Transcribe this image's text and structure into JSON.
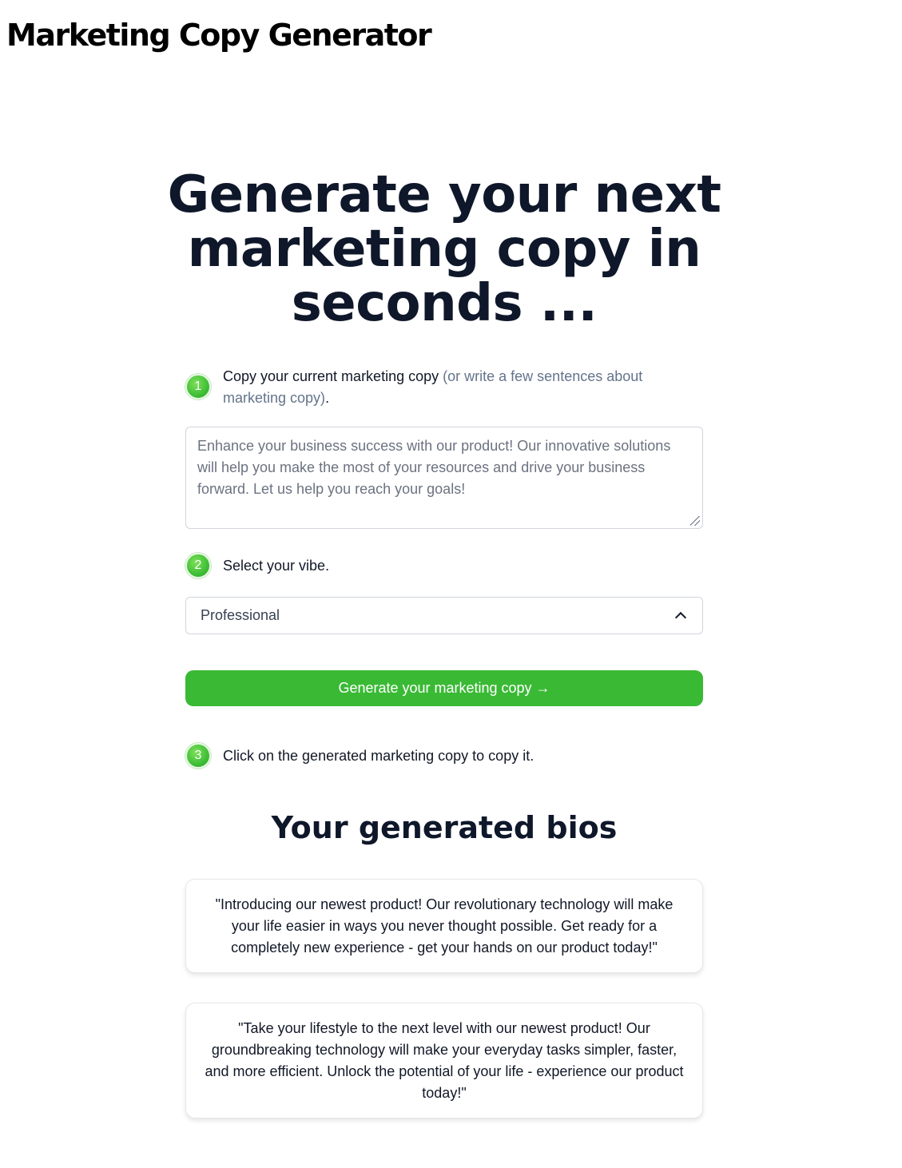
{
  "app": {
    "title": "Marketing Copy Generator"
  },
  "hero": {
    "headline": "Generate your next marketing copy in seconds ..."
  },
  "steps": [
    {
      "number": "1",
      "label": "Copy your current marketing copy",
      "hint": "(or write a few sentences about marketing copy)",
      "period": "."
    },
    {
      "number": "2",
      "label": "Select your vibe."
    },
    {
      "number": "3",
      "label": "Click on the generated marketing copy to copy it."
    }
  ],
  "input": {
    "placeholder": "Enhance your business success with our product! Our innovative solutions will help you make the most of your resources and drive your business forward. Let us help you reach your goals!"
  },
  "vibe": {
    "selected": "Professional"
  },
  "generate_button": {
    "label": "Generate your marketing copy →"
  },
  "results": {
    "title": "Your generated bios",
    "bios": [
      "\"Introducing our newest product! Our revolutionary technology will make your life easier in ways you never thought possible. Get ready for a completely new experience - get your hands on our product today!\"",
      "\"Take your lifestyle to the next level with our newest product! Our groundbreaking technology will make your everyday tasks simpler, faster, and more efficient. Unlock the potential of your life - experience our product today!\""
    ]
  },
  "colors": {
    "accent": "#3ab935",
    "heading": "#0f172a",
    "muted": "#64748b"
  }
}
